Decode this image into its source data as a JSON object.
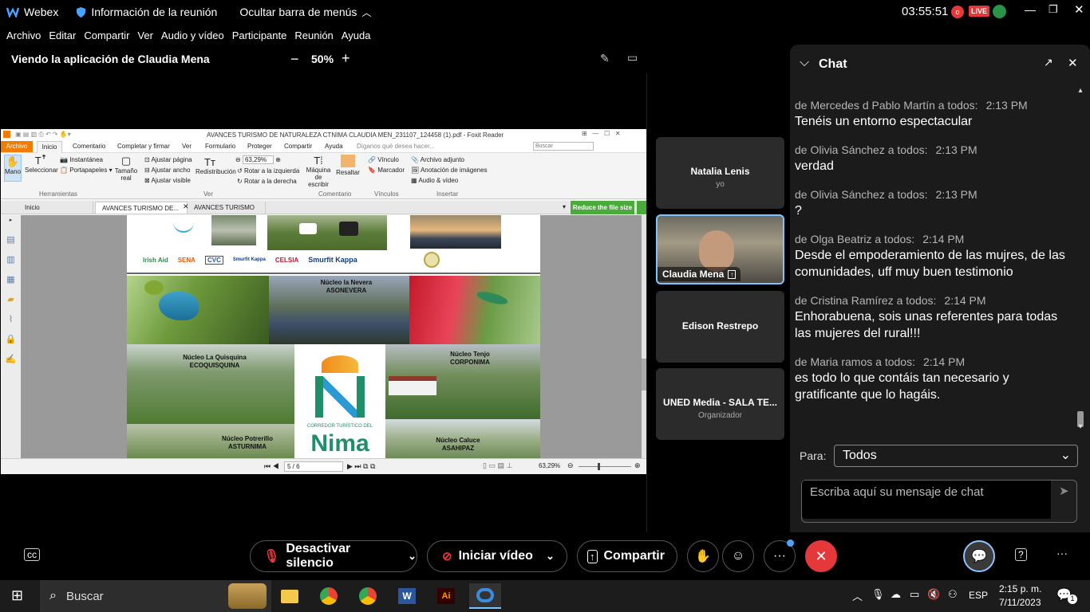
{
  "titlebar": {
    "app": "Webex",
    "meeting_info": "Información de la reunión",
    "hide_menu": "Ocultar barra de menús",
    "time": "03:55:51",
    "live_badge": "LIVE"
  },
  "menubar": [
    "Archivo",
    "Editar",
    "Compartir",
    "Ver",
    "Audio y vídeo",
    "Participante",
    "Reunión",
    "Ayuda"
  ],
  "sharebar": {
    "viewing": "Viendo la aplicación de Claudia Mena",
    "zoom": "50%"
  },
  "foxit": {
    "window_title": "AVANCES TURISMO DE NATURALEZA CTNIMA CLAUDIA MEN_231107_124458 (1).pdf - Foxit Reader",
    "ribbon_tabs": [
      "Archivo",
      "Inicio",
      "Comentario",
      "Completar y firmar",
      "Ver",
      "Formulario",
      "Proteger",
      "Compartir",
      "Ayuda"
    ],
    "tell_me": "Díganos qué desea hacer...",
    "search_placeholder": "Buscar",
    "tools": {
      "mano": "Mano",
      "seleccionar": "Seleccionar",
      "instantanea": "Instantánea",
      "portapapeles": "Portapapeles",
      "herramientas": "Herramientas",
      "tamano": "Tamaño real",
      "ajustar_pagina": "Ajustar página",
      "ajustar_ancho": "Ajustar ancho",
      "ajustar_visible": "Ajustar visible",
      "zoom": "63,29%",
      "rotar_izq": "Rotar a la izquierda",
      "rotar_der": "Rotar a la derecha",
      "redistribucion": "Redistribución",
      "ver": "Ver",
      "maquina": "Máquina de escribir",
      "resaltar": "Resaltar",
      "comentario": "Comentario",
      "vinculo": "Vínculo",
      "marcador": "Marcador",
      "vinculos": "Vínculos",
      "archivo_adjunto": "Archivo adjunto",
      "anotacion": "Anotación de imágenes",
      "audio_video": "Audio & vídeo",
      "insertar": "Insertar"
    },
    "doc_tabs": [
      "Inicio",
      "AVANCES TURISMO DE...",
      "AVANCES TURISMO D..."
    ],
    "reduce": "Reduce the file size",
    "page_nav": "5 / 6",
    "status_zoom": "63,29%",
    "logos": [
      "Irish Aid",
      "SENA",
      "CVC",
      "Smurfit Kappa",
      "CELSIA",
      "Smurfit Kappa"
    ],
    "captions": {
      "nevera1": "Núcleo la Nevera",
      "nevera2": "ASONEVERA",
      "quisquina1": "Núcleo La Quisquina",
      "quisquina2": "ECOQUISQUINA",
      "tenjo1": "Núcleo Tenjo",
      "tenjo2": "CORPONIMA",
      "potrerillo1": "Núcleo Potrerillo",
      "potrerillo2": "ASTURNIMA",
      "caluce1": "Núcleo Caluce",
      "caluce2": "ASAHIPAZ",
      "corredor": "CORREDOR TURÍSTICO DEL",
      "nima": "Nima"
    }
  },
  "tiles": [
    {
      "name": "Natalia Lenis",
      "sub": "yo"
    },
    {
      "name": "Claudia Mena",
      "sub": ""
    },
    {
      "name": "Edison Restrepo",
      "sub": ""
    },
    {
      "name": "UNED Media - SALA TE...",
      "sub": "Organizador"
    }
  ],
  "chat": {
    "title": "Chat",
    "messages": [
      {
        "from": "de Mercedes d Pablo Martín a todos:",
        "time": "2:13 PM",
        "text": "Tenéis un entorno espectacular"
      },
      {
        "from": "de Olivia Sánchez a todos:",
        "time": "2:13 PM",
        "text": "verdad"
      },
      {
        "from": "de Olivia Sánchez a todos:",
        "time": "2:13 PM",
        "text": "?"
      },
      {
        "from": "de Olga Beatriz a todos:",
        "time": "2:14 PM",
        "text": "Desde el empoderamiento de las mujres, de las comunidades, uff muy buen testimonio"
      },
      {
        "from": "de Cristina Ramírez a todos:",
        "time": "2:14 PM",
        "text": "Enhorabuena, sois unas referentes para todas las mujeres del rural!!!"
      },
      {
        "from": "de Maria ramos a todos:",
        "time": "2:14 PM",
        "text": "es todo lo que contáis tan necesario y gratificante que lo hagáis."
      }
    ],
    "to_label": "Para:",
    "to_value": "Todos",
    "input_placeholder": "Escriba aquí su mensaje de chat"
  },
  "controls": {
    "mute": "Desactivar silencio",
    "video": "Iniciar vídeo",
    "share": "Compartir"
  },
  "taskbar": {
    "search": "Buscar",
    "lang": "ESP",
    "time": "2:15 p. m.",
    "date": "7/11/2023",
    "notif": "1"
  }
}
